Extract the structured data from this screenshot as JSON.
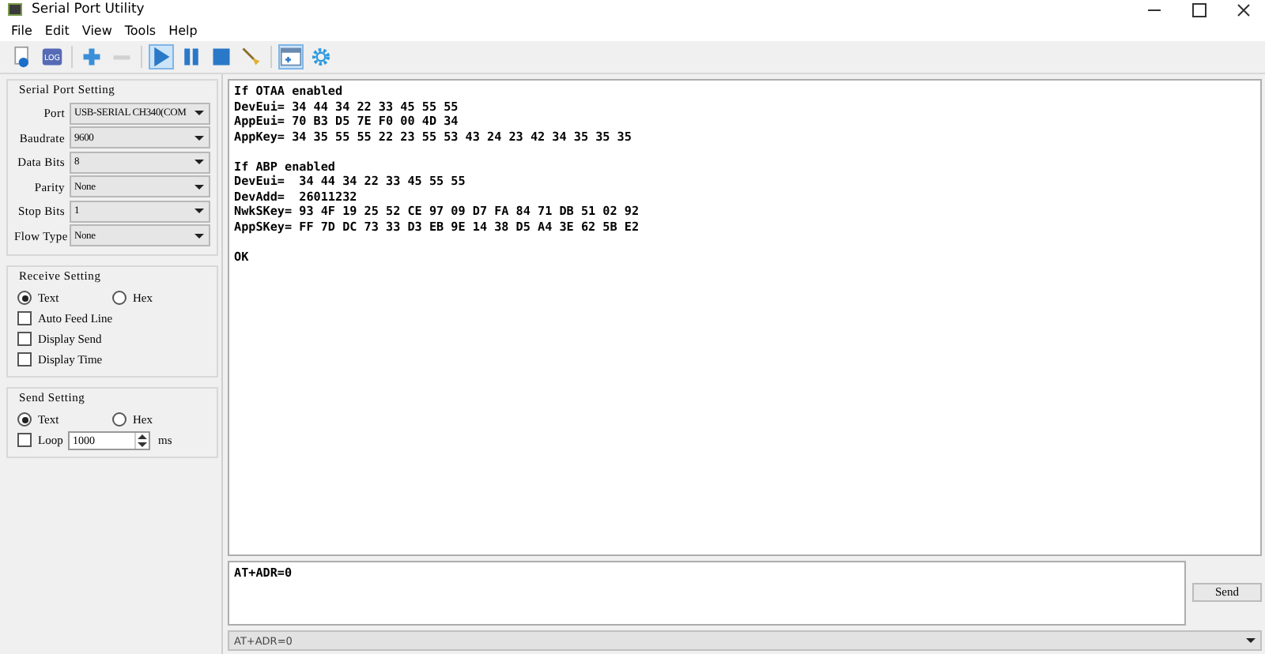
{
  "window": {
    "title": "Serial Port Utility"
  },
  "menu": [
    "File",
    "Edit",
    "View",
    "Tools",
    "Help"
  ],
  "toolbar": [
    {
      "kind": "open",
      "active": false,
      "disabled": false
    },
    {
      "kind": "log",
      "label": "LOG",
      "active": false,
      "disabled": false
    },
    {
      "kind": "add",
      "active": false,
      "disabled": false
    },
    {
      "kind": "remove",
      "active": false,
      "disabled": true
    },
    {
      "kind": "play",
      "active": true,
      "disabled": false
    },
    {
      "kind": "pause",
      "active": false,
      "disabled": false
    },
    {
      "kind": "stop",
      "active": false,
      "disabled": false
    },
    {
      "kind": "clear",
      "active": false,
      "disabled": false
    },
    {
      "kind": "window",
      "active": true,
      "disabled": false
    },
    {
      "kind": "settings",
      "active": false,
      "disabled": false
    }
  ],
  "serial_port_setting": {
    "title": "Serial Port Setting",
    "fields": [
      {
        "label": "Port",
        "value": "USB-SERIAL CH340(COM"
      },
      {
        "label": "Baudrate",
        "value": "9600"
      },
      {
        "label": "Data Bits",
        "value": "8"
      },
      {
        "label": "Parity",
        "value": "None"
      },
      {
        "label": "Stop Bits",
        "value": "1"
      },
      {
        "label": "Flow Type",
        "value": "None"
      }
    ]
  },
  "receive_setting": {
    "title": "Receive Setting",
    "modes": [
      {
        "label": "Text",
        "selected": true
      },
      {
        "label": "Hex",
        "selected": false
      }
    ],
    "options": [
      {
        "label": "Auto Feed Line",
        "checked": false
      },
      {
        "label": "Display Send",
        "checked": false
      },
      {
        "label": "Display Time",
        "checked": false
      }
    ]
  },
  "send_setting": {
    "title": "Send Setting",
    "modes": [
      {
        "label": "Text",
        "selected": true
      },
      {
        "label": "Hex",
        "selected": false
      }
    ],
    "loop": {
      "label": "Loop",
      "checked": false,
      "value": "1000",
      "unit": "ms"
    }
  },
  "output": [
    [
      "If OTAA enabled",
      "DevEui= 34 44 34 22 33 45 55 55",
      "AppEui= 70 B3 D5 7E F0 00 4D 34",
      "AppKey= 34 35 55 55 22 23 55 53 43 24 23 42 34 35 35 35"
    ],
    [
      "If ABP enabled",
      "DevEui=  34 44 34 22 33 45 55 55",
      "DevAdd=  26011232",
      "NwkSKey= 93 4F 19 25 52 CE 97 09 D7 FA 84 71 DB 51 02 92",
      "AppSKey= FF 7D DC 73 33 D3 EB 9E 14 38 D5 A4 3E 62 5B E2"
    ],
    [
      "OK"
    ]
  ],
  "input": {
    "value": "AT+ADR=0"
  },
  "send_button": "Send",
  "history": {
    "value": "AT+ADR=0"
  }
}
